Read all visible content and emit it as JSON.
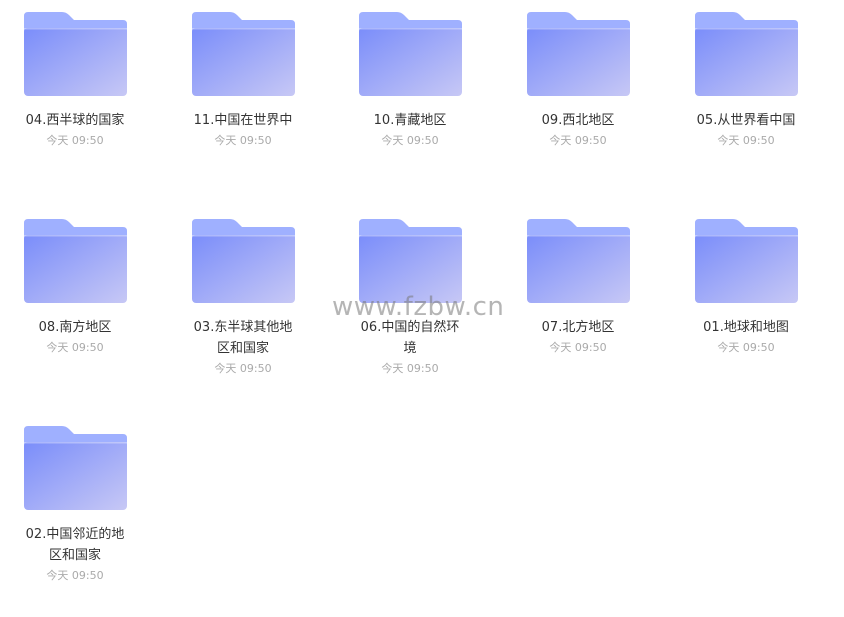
{
  "colors": {
    "folder_back": "#9fb0ff",
    "folder_front_start": "#7a8dfa",
    "folder_front_end": "#c7c8f5",
    "name_text": "#333333",
    "time_text": "#aaaaaa"
  },
  "folders": [
    {
      "name_lines": [
        "04.西半球的国家"
      ],
      "time": "今天 09:50"
    },
    {
      "name_lines": [
        "11.中国在世界中"
      ],
      "time": "今天 09:50"
    },
    {
      "name_lines": [
        "10.青藏地区"
      ],
      "time": "今天 09:50"
    },
    {
      "name_lines": [
        "09.西北地区"
      ],
      "time": "今天 09:50"
    },
    {
      "name_lines": [
        "05.从世界看中国"
      ],
      "time": "今天 09:50"
    },
    {
      "name_lines": [
        "08.南方地区"
      ],
      "time": "今天 09:50"
    },
    {
      "name_lines": [
        "03.东半球其他地",
        "区和国家"
      ],
      "time": "今天 09:50"
    },
    {
      "name_lines": [
        "06.中国的自然环",
        "境"
      ],
      "time": "今天 09:50"
    },
    {
      "name_lines": [
        "07.北方地区"
      ],
      "time": "今天 09:50"
    },
    {
      "name_lines": [
        "01.地球和地图"
      ],
      "time": "今天 09:50"
    },
    {
      "name_lines": [
        "02.中国邻近的地",
        "区和国家"
      ],
      "time": "今天 09:50"
    }
  ],
  "watermark": "www.fzbw.cn"
}
